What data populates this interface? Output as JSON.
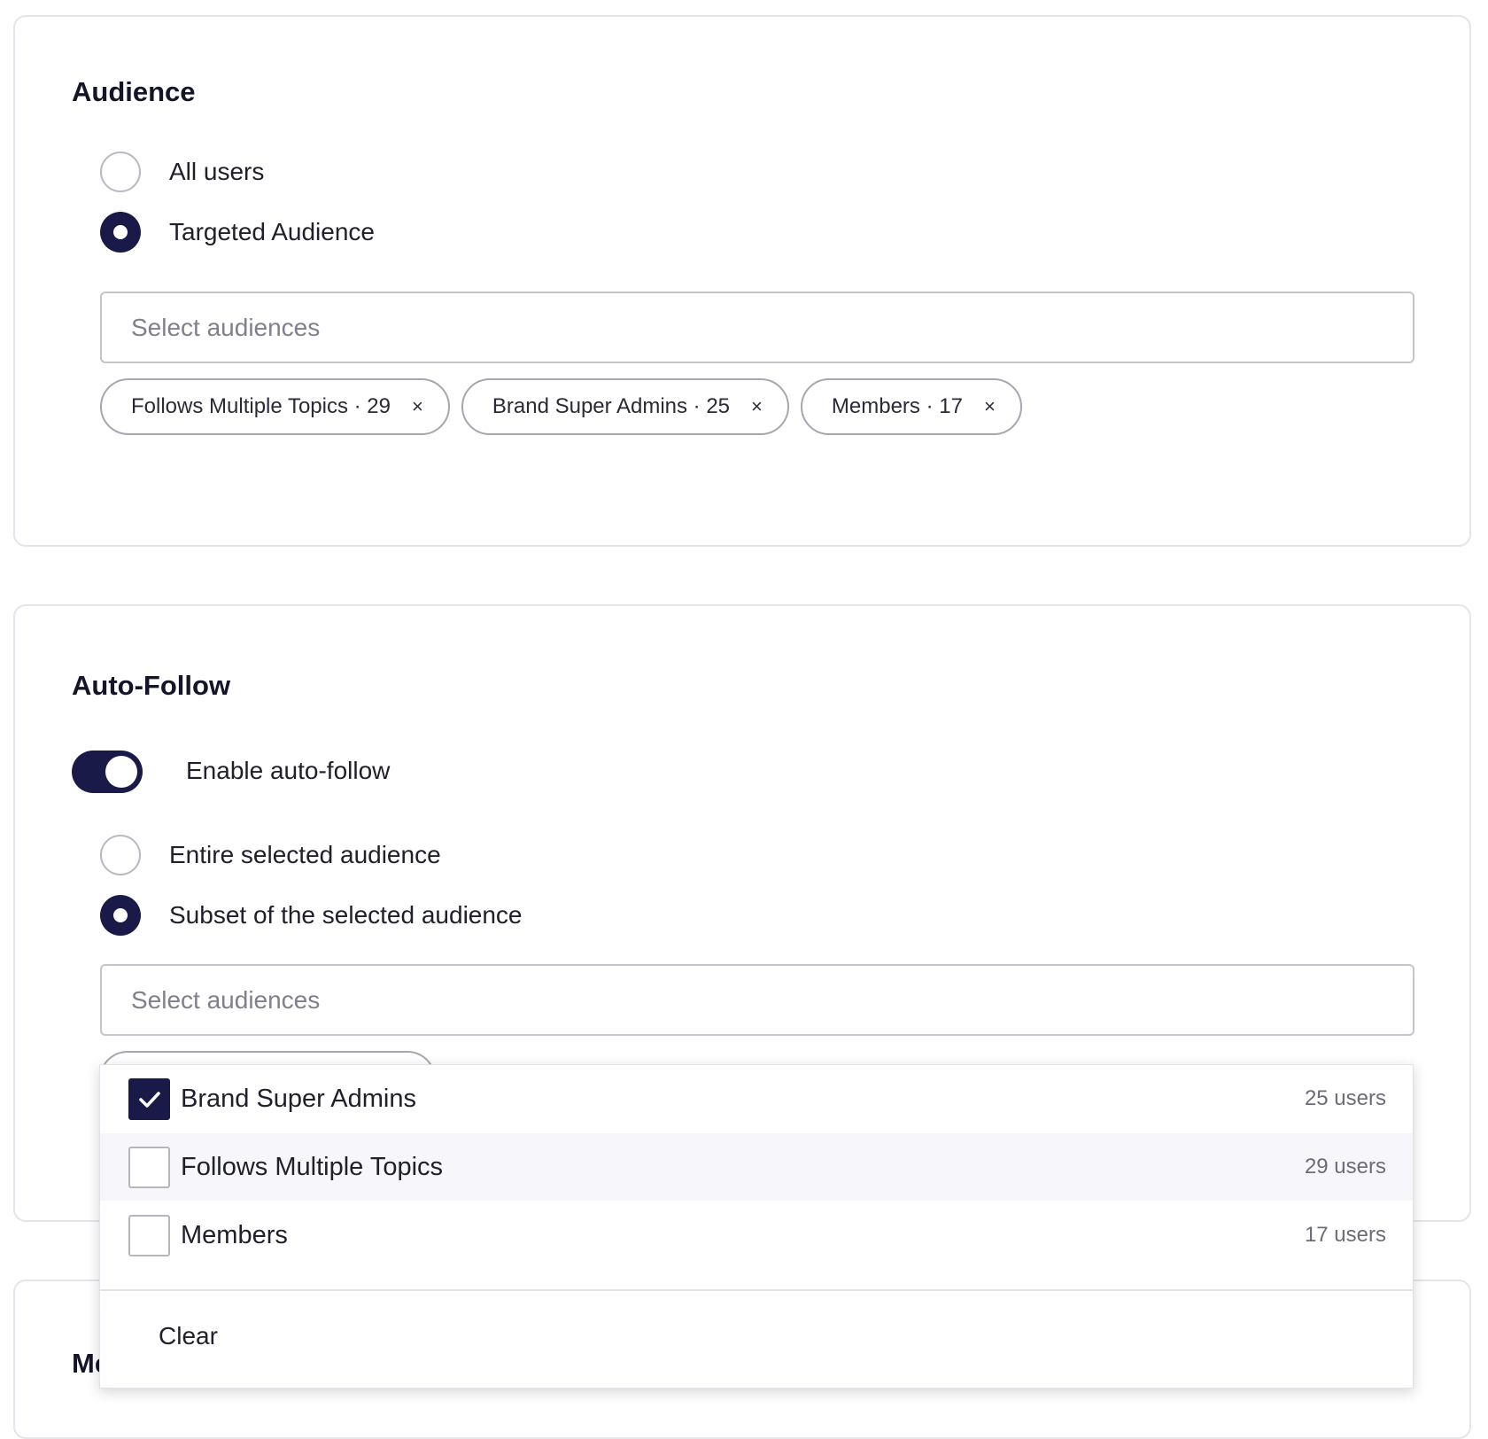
{
  "audience": {
    "title": "Audience",
    "options": [
      {
        "label": "All users",
        "selected": false
      },
      {
        "label": "Targeted Audience",
        "selected": true
      }
    ],
    "select_placeholder": "Select audiences",
    "chips": [
      {
        "label": "Follows Multiple Topics · 29"
      },
      {
        "label": "Brand Super Admins · 25"
      },
      {
        "label": "Members · 17"
      }
    ],
    "chip_remove_glyph": "×"
  },
  "autofollow": {
    "title": "Auto-Follow",
    "toggle_label": "Enable auto-follow",
    "toggle_on": true,
    "options": [
      {
        "label": "Entire selected audience",
        "selected": false
      },
      {
        "label": "Subset of the selected audience",
        "selected": true
      }
    ],
    "select_placeholder": "Select audiences"
  },
  "dropdown": {
    "items": [
      {
        "label": "Brand Super Admins",
        "count": "25 users",
        "checked": true
      },
      {
        "label": "Follows Multiple Topics",
        "count": "29 users",
        "checked": false
      },
      {
        "label": "Members",
        "count": "17 users",
        "checked": false
      }
    ],
    "clear_label": "Clear"
  },
  "third_card": {
    "title_partial": "Me"
  },
  "colors": {
    "accent": "#1a1a48",
    "border": "#e4e4ea",
    "muted_text": "#6c6c78"
  }
}
